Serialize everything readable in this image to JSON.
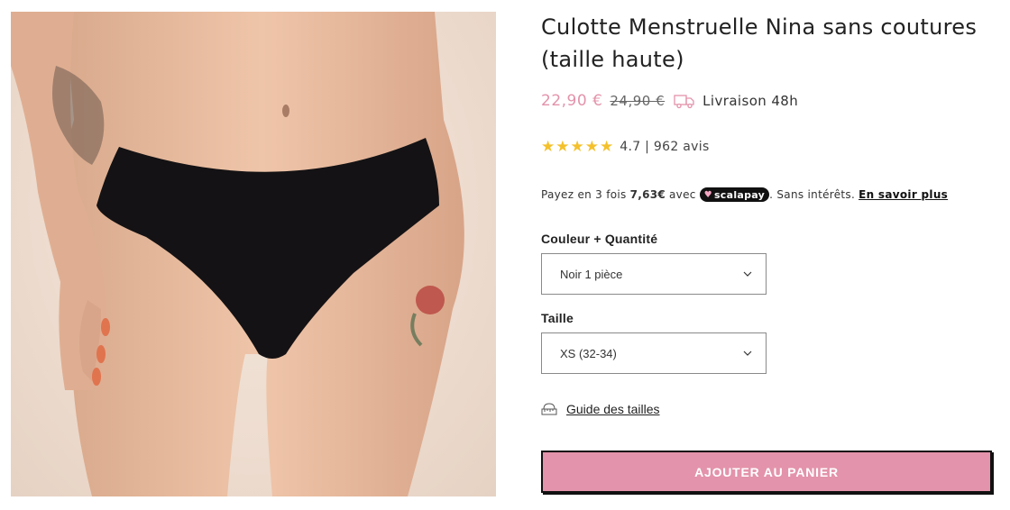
{
  "product": {
    "title": "Culotte Menstruelle Nina sans coutures (taille haute)",
    "price_sale": "22,90 €",
    "price_regular": "24,90 €",
    "delivery": "Livraison 48h",
    "delivery_icon": "truck-icon",
    "rating": {
      "stars": 5,
      "text": "4.7 | 962 avis",
      "star_color": "#f4c12c"
    },
    "installments": {
      "prefix": "Payez en 3 fois",
      "amount": "7,63€",
      "middle": "avec",
      "brand": "scalapay",
      "suffix": ". Sans intérêts.",
      "link": "En savoir plus"
    },
    "options": {
      "color_label": "Couleur + Quantité",
      "color_value": "Noir 1 pièce",
      "size_label": "Taille",
      "size_value": "XS (32-34)"
    },
    "size_guide": "Guide des tailles",
    "add_to_cart": "AJOUTER AU PANIER"
  },
  "colors": {
    "accent_pink": "#e393ab",
    "text_dark": "#222222"
  }
}
